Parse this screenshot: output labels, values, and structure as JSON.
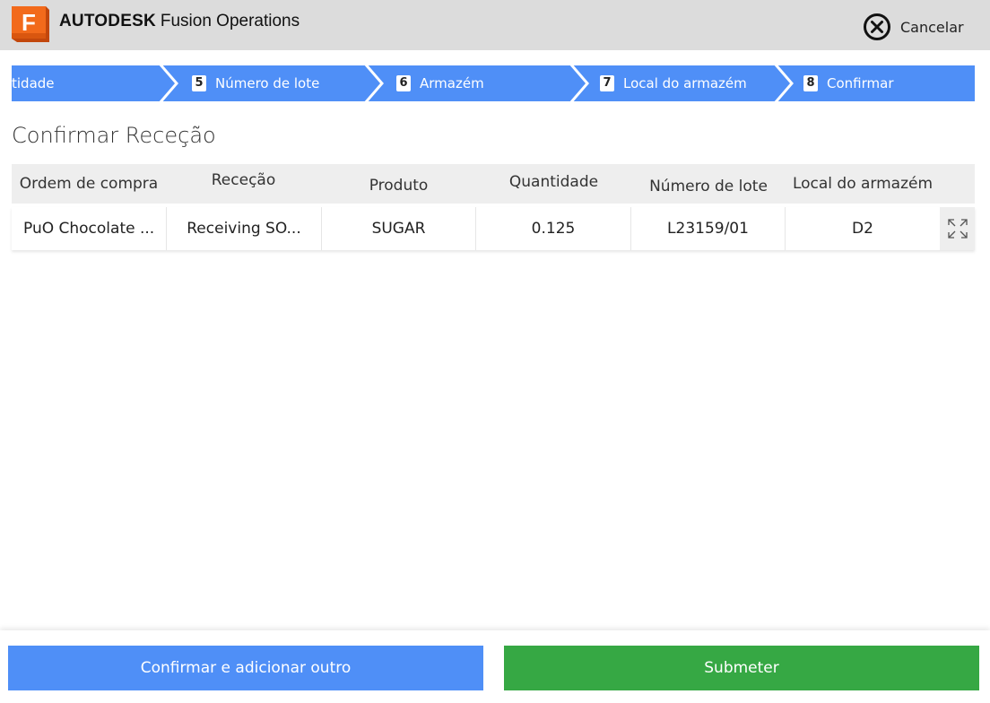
{
  "header": {
    "logo_letter": "F",
    "brand_main": "AUTODESK",
    "brand_product": "Fusion Operations",
    "cancel_label": "Cancelar",
    "logo_color": "#f26a1b",
    "header_bg": "#dcdcdc"
  },
  "stepper": {
    "steps": [
      {
        "num": "",
        "label": "tidade"
      },
      {
        "num": "5",
        "label": "Número de lote"
      },
      {
        "num": "6",
        "label": "Armazém"
      },
      {
        "num": "7",
        "label": "Local do armazém"
      },
      {
        "num": "8",
        "label": "Confirmar"
      }
    ],
    "color": "#4f8ff7"
  },
  "main": {
    "title": "Confirmar Receção",
    "table": {
      "columns": [
        "Ordem de compra",
        "Receção",
        "Produto",
        "Quantidade",
        "Número de lote",
        "Local do armazém"
      ],
      "rows": [
        [
          "PuO Chocolate ...",
          "Receiving SO...",
          "SUGAR",
          "0.125",
          "L23159/01",
          "D2"
        ]
      ],
      "expand_icon": "expand-icon"
    }
  },
  "footer": {
    "confirm_add_label": "Confirmar e adicionar outro",
    "submit_label": "Submeter",
    "confirm_color": "#4f8ff7",
    "submit_color": "#36a844"
  }
}
